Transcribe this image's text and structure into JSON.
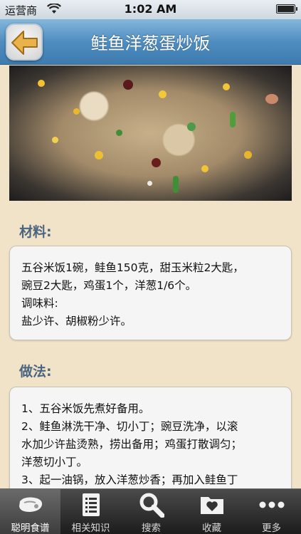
{
  "status_bar": {
    "carrier": "运营商",
    "time": "1:02 AM"
  },
  "nav": {
    "title": "鲑鱼洋葱蛋炒饭",
    "back_icon": "back-arrow-icon"
  },
  "ingredients": {
    "heading": "材料:",
    "lines": [
      "五谷米饭1碗，鲑鱼150克，甜玉米粒2大匙，",
      "豌豆2大匙，鸡蛋1个，洋葱1/6个。",
      "调味料:",
      "盐少许、胡椒粉少许。"
    ]
  },
  "method": {
    "heading": "做法:",
    "lines": [
      "1、五谷米饭先煮好备用。",
      "2、鲑鱼淋洗干净、切小丁；豌豆洗净，以滚",
      "水加少许盐烫熟，捞出备用；鸡蛋打散调匀；",
      "洋葱切小丁。",
      "3、起一油锅，放入洋葱炒香；再加入鲑鱼丁"
    ]
  },
  "tabs": [
    {
      "label": "聪明食谱",
      "icon": "steak-icon"
    },
    {
      "label": "相关知识",
      "icon": "document-icon"
    },
    {
      "label": "搜索",
      "icon": "search-icon"
    },
    {
      "label": "收藏",
      "icon": "favorites-folder-icon"
    },
    {
      "label": "更多",
      "icon": "more-dots-icon"
    }
  ],
  "colors": {
    "nav_blue": "#4f8dc0",
    "background": "#f1e3c8",
    "heading": "#4b6580"
  }
}
